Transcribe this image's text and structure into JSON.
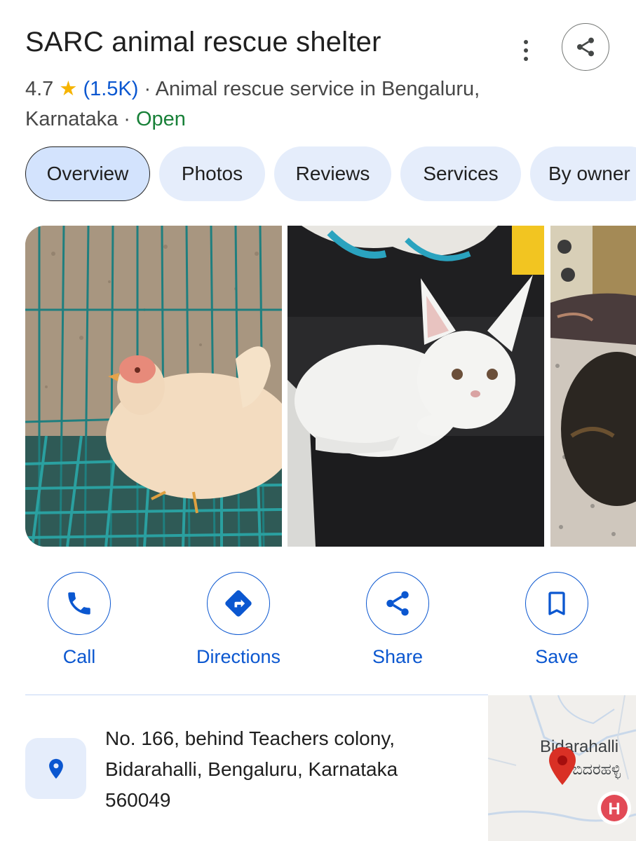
{
  "place": {
    "name": "SARC animal rescue shelter",
    "rating": "4.7",
    "star": "★",
    "review_count": "(1.5K)",
    "separator": " · ",
    "category_line": "Animal rescue service in Bengaluru, Karnataka",
    "status": "Open"
  },
  "icons": {
    "more": "more-vert-icon",
    "share": "share-icon",
    "call": "phone-icon",
    "directions": "directions-icon",
    "save": "bookmark-icon",
    "location": "location-pin-icon"
  },
  "tabs": [
    {
      "label": "Overview",
      "active": true
    },
    {
      "label": "Photos",
      "active": false
    },
    {
      "label": "Reviews",
      "active": false
    },
    {
      "label": "Services",
      "active": false
    },
    {
      "label": "By owner",
      "active": false
    }
  ],
  "actions": {
    "call": "Call",
    "directions": "Directions",
    "share": "Share",
    "save": "Save"
  },
  "address": {
    "line1": "No. 166, behind Teachers colony,",
    "line2": "Bidarahalli, Bengaluru, Karnataka",
    "line3": "560049"
  },
  "map": {
    "place_label_en": "Bidarahalli",
    "place_label_kn": "ಬಿದರಹಳ್ಳಿ",
    "hospital_marker": "H"
  },
  "colors": {
    "accent": "#0b57d0",
    "open": "#188038",
    "star": "#f6b400",
    "chip_bg": "#e5edfb",
    "pin": "#d93025"
  }
}
